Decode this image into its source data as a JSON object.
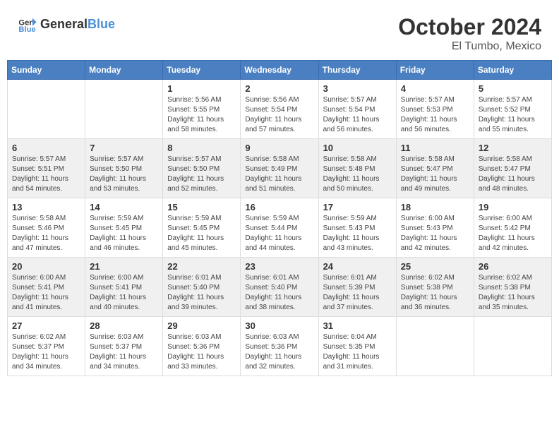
{
  "header": {
    "logo_general": "General",
    "logo_blue": "Blue",
    "month_title": "October 2024",
    "location": "El Tumbo, Mexico"
  },
  "days_of_week": [
    "Sunday",
    "Monday",
    "Tuesday",
    "Wednesday",
    "Thursday",
    "Friday",
    "Saturday"
  ],
  "weeks": [
    [
      {
        "day": "",
        "content": ""
      },
      {
        "day": "",
        "content": ""
      },
      {
        "day": "1",
        "content": "Sunrise: 5:56 AM\nSunset: 5:55 PM\nDaylight: 11 hours and 58 minutes."
      },
      {
        "day": "2",
        "content": "Sunrise: 5:56 AM\nSunset: 5:54 PM\nDaylight: 11 hours and 57 minutes."
      },
      {
        "day": "3",
        "content": "Sunrise: 5:57 AM\nSunset: 5:54 PM\nDaylight: 11 hours and 56 minutes."
      },
      {
        "day": "4",
        "content": "Sunrise: 5:57 AM\nSunset: 5:53 PM\nDaylight: 11 hours and 56 minutes."
      },
      {
        "day": "5",
        "content": "Sunrise: 5:57 AM\nSunset: 5:52 PM\nDaylight: 11 hours and 55 minutes."
      }
    ],
    [
      {
        "day": "6",
        "content": "Sunrise: 5:57 AM\nSunset: 5:51 PM\nDaylight: 11 hours and 54 minutes."
      },
      {
        "day": "7",
        "content": "Sunrise: 5:57 AM\nSunset: 5:50 PM\nDaylight: 11 hours and 53 minutes."
      },
      {
        "day": "8",
        "content": "Sunrise: 5:57 AM\nSunset: 5:50 PM\nDaylight: 11 hours and 52 minutes."
      },
      {
        "day": "9",
        "content": "Sunrise: 5:58 AM\nSunset: 5:49 PM\nDaylight: 11 hours and 51 minutes."
      },
      {
        "day": "10",
        "content": "Sunrise: 5:58 AM\nSunset: 5:48 PM\nDaylight: 11 hours and 50 minutes."
      },
      {
        "day": "11",
        "content": "Sunrise: 5:58 AM\nSunset: 5:47 PM\nDaylight: 11 hours and 49 minutes."
      },
      {
        "day": "12",
        "content": "Sunrise: 5:58 AM\nSunset: 5:47 PM\nDaylight: 11 hours and 48 minutes."
      }
    ],
    [
      {
        "day": "13",
        "content": "Sunrise: 5:58 AM\nSunset: 5:46 PM\nDaylight: 11 hours and 47 minutes."
      },
      {
        "day": "14",
        "content": "Sunrise: 5:59 AM\nSunset: 5:45 PM\nDaylight: 11 hours and 46 minutes."
      },
      {
        "day": "15",
        "content": "Sunrise: 5:59 AM\nSunset: 5:45 PM\nDaylight: 11 hours and 45 minutes."
      },
      {
        "day": "16",
        "content": "Sunrise: 5:59 AM\nSunset: 5:44 PM\nDaylight: 11 hours and 44 minutes."
      },
      {
        "day": "17",
        "content": "Sunrise: 5:59 AM\nSunset: 5:43 PM\nDaylight: 11 hours and 43 minutes."
      },
      {
        "day": "18",
        "content": "Sunrise: 6:00 AM\nSunset: 5:43 PM\nDaylight: 11 hours and 42 minutes."
      },
      {
        "day": "19",
        "content": "Sunrise: 6:00 AM\nSunset: 5:42 PM\nDaylight: 11 hours and 42 minutes."
      }
    ],
    [
      {
        "day": "20",
        "content": "Sunrise: 6:00 AM\nSunset: 5:41 PM\nDaylight: 11 hours and 41 minutes."
      },
      {
        "day": "21",
        "content": "Sunrise: 6:00 AM\nSunset: 5:41 PM\nDaylight: 11 hours and 40 minutes."
      },
      {
        "day": "22",
        "content": "Sunrise: 6:01 AM\nSunset: 5:40 PM\nDaylight: 11 hours and 39 minutes."
      },
      {
        "day": "23",
        "content": "Sunrise: 6:01 AM\nSunset: 5:40 PM\nDaylight: 11 hours and 38 minutes."
      },
      {
        "day": "24",
        "content": "Sunrise: 6:01 AM\nSunset: 5:39 PM\nDaylight: 11 hours and 37 minutes."
      },
      {
        "day": "25",
        "content": "Sunrise: 6:02 AM\nSunset: 5:38 PM\nDaylight: 11 hours and 36 minutes."
      },
      {
        "day": "26",
        "content": "Sunrise: 6:02 AM\nSunset: 5:38 PM\nDaylight: 11 hours and 35 minutes."
      }
    ],
    [
      {
        "day": "27",
        "content": "Sunrise: 6:02 AM\nSunset: 5:37 PM\nDaylight: 11 hours and 34 minutes."
      },
      {
        "day": "28",
        "content": "Sunrise: 6:03 AM\nSunset: 5:37 PM\nDaylight: 11 hours and 34 minutes."
      },
      {
        "day": "29",
        "content": "Sunrise: 6:03 AM\nSunset: 5:36 PM\nDaylight: 11 hours and 33 minutes."
      },
      {
        "day": "30",
        "content": "Sunrise: 6:03 AM\nSunset: 5:36 PM\nDaylight: 11 hours and 32 minutes."
      },
      {
        "day": "31",
        "content": "Sunrise: 6:04 AM\nSunset: 5:35 PM\nDaylight: 11 hours and 31 minutes."
      },
      {
        "day": "",
        "content": ""
      },
      {
        "day": "",
        "content": ""
      }
    ]
  ]
}
